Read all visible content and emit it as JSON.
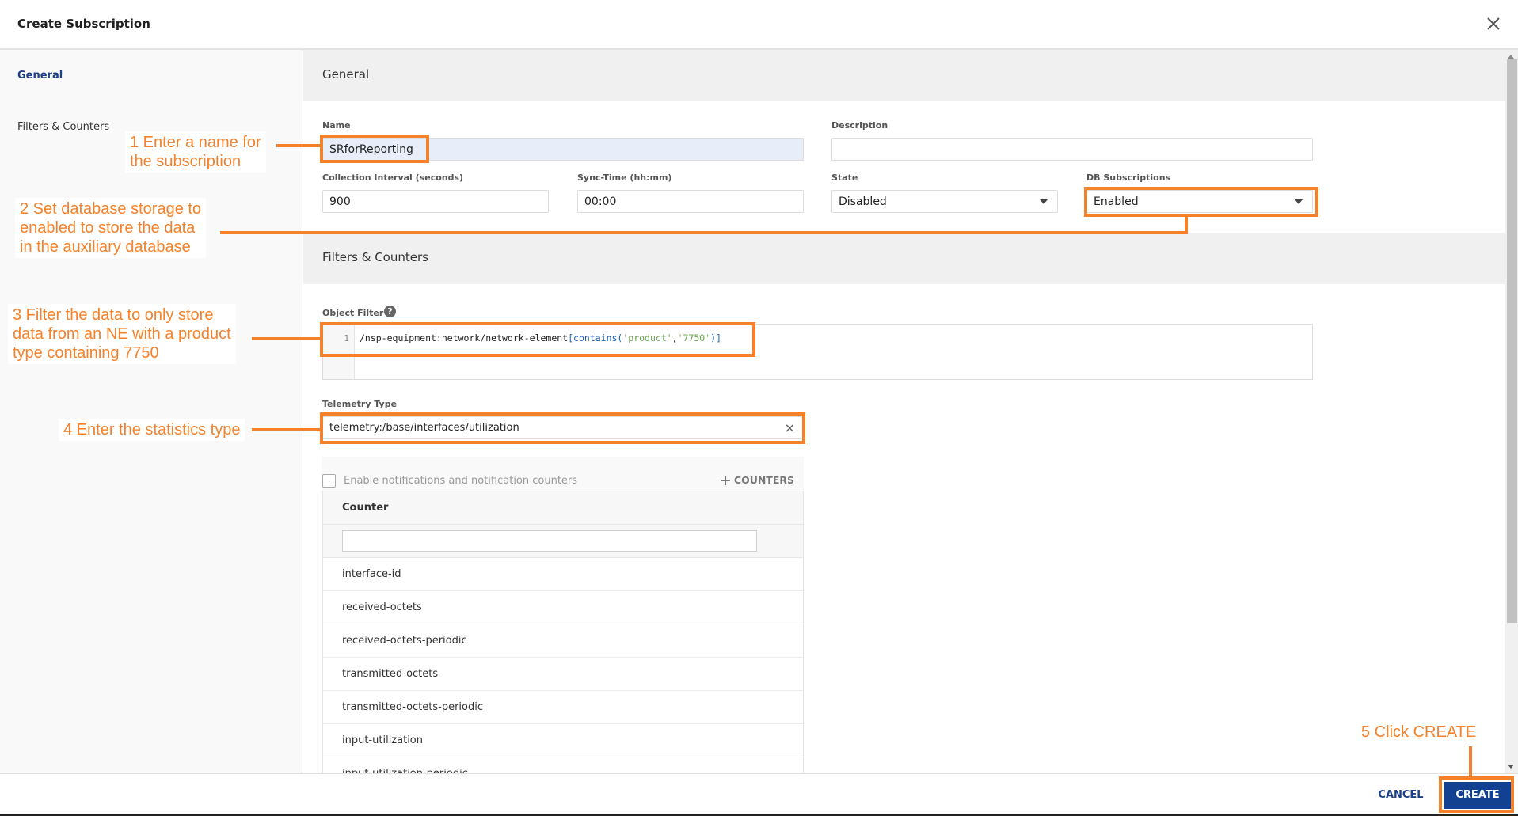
{
  "dialog": {
    "title": "Create Subscription",
    "close_icon": "close-icon"
  },
  "sidebar": {
    "items": [
      {
        "label": "General",
        "active": true
      },
      {
        "label": "Filters & Counters",
        "active": false
      }
    ]
  },
  "general": {
    "section_title": "General",
    "name": {
      "label": "Name",
      "value": "SRforReporting"
    },
    "description": {
      "label": "Description",
      "value": ""
    },
    "collection_interval": {
      "label": "Collection Interval (seconds)",
      "value": "900"
    },
    "sync_time": {
      "label": "Sync-Time (hh:mm)",
      "value": "00:00"
    },
    "state": {
      "label": "State",
      "value": "Disabled"
    },
    "db_subscriptions": {
      "label": "DB Subscriptions",
      "value": "Enabled"
    }
  },
  "filters": {
    "section_title": "Filters & Counters",
    "object_filter": {
      "label": "Object Filter",
      "help_icon": "?",
      "line_number": "1",
      "code_path": "/nsp-equipment:network/network-element",
      "code_open": "[contains(",
      "code_arg1": "'product'",
      "code_comma": ",",
      "code_arg2": "'7750'",
      "code_close": ")]"
    },
    "telemetry_type": {
      "label": "Telemetry Type",
      "value": "telemetry:/base/interfaces/utilization",
      "clear_icon": "×"
    },
    "notifications_checkbox": {
      "label": "Enable notifications and notification counters",
      "checked": false
    },
    "add_counters_button": {
      "icon": "+",
      "label": "COUNTERS"
    },
    "counter_table": {
      "header": "Counter",
      "filter_value": "",
      "rows": [
        "interface-id",
        "received-octets",
        "received-octets-periodic",
        "transmitted-octets",
        "transmitted-octets-periodic",
        "input-utilization",
        "input-utilization-periodic"
      ]
    }
  },
  "footer": {
    "cancel_label": "CANCEL",
    "create_label": "CREATE"
  },
  "annotations": {
    "step1": "1 Enter a name for\nthe subscription",
    "step2": "2 Set database storage to\nenabled to store the data\nin the auxiliary database",
    "step3": "3 Filter the data to only store\ndata from an NE with a product\ntype containing 7750",
    "step4": "4 Enter the statistics type",
    "step5": "5 Click CREATE",
    "color": "#f5822a"
  },
  "colors": {
    "primary": "#124191",
    "active_nav": "#1c3f8a",
    "section_bg": "#f0f0f0"
  }
}
